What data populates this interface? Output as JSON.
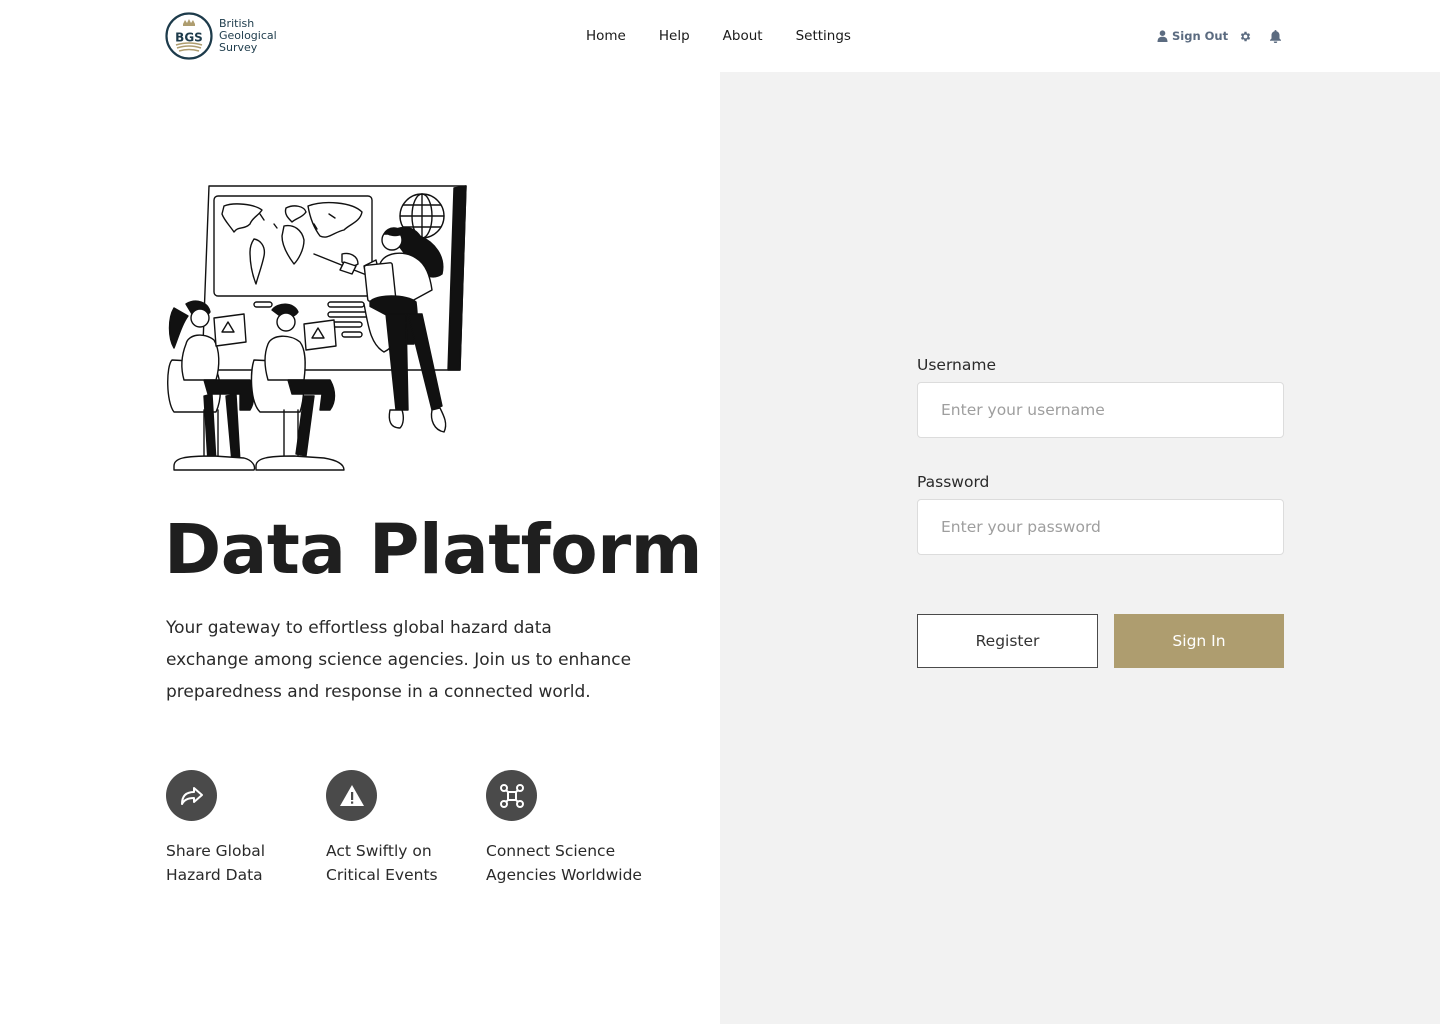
{
  "brand": {
    "logo_abbr": "BGS",
    "name_line1": "British",
    "name_line2": "Geological",
    "name_line3": "Survey"
  },
  "nav": {
    "items": [
      {
        "label": "Home"
      },
      {
        "label": "Help"
      },
      {
        "label": "About"
      },
      {
        "label": "Settings"
      }
    ]
  },
  "header_actions": {
    "sign_out_label": "Sign Out",
    "icons": [
      "user-icon",
      "gear-icon",
      "bell-icon"
    ]
  },
  "hero": {
    "title": "Data Platform",
    "tagline": "Your gateway to effortless global hazard data exchange among science agencies. Join us to enhance preparedness and response in a connected world."
  },
  "features": [
    {
      "icon": "share-arrow-icon",
      "line1": "Share Global",
      "line2": "Hazard Data"
    },
    {
      "icon": "warning-triangle-icon",
      "line1": "Act Swiftly on",
      "line2": "Critical Events"
    },
    {
      "icon": "network-nodes-icon",
      "line1": "Connect Science",
      "line2": "Agencies Worldwide"
    }
  ],
  "login": {
    "username_label": "Username",
    "username_placeholder": "Enter your username",
    "username_value": "",
    "password_label": "Password",
    "password_placeholder": "Enter your password",
    "password_value": "",
    "register_label": "Register",
    "signin_label": "Sign In"
  },
  "colors": {
    "accent_gold": "#ae9d6f",
    "panel_bg": "#f2f2f2",
    "icon_circle": "#4a4a4a",
    "brand_navy": "#1d3b4b",
    "header_action": "#5b6b80"
  }
}
